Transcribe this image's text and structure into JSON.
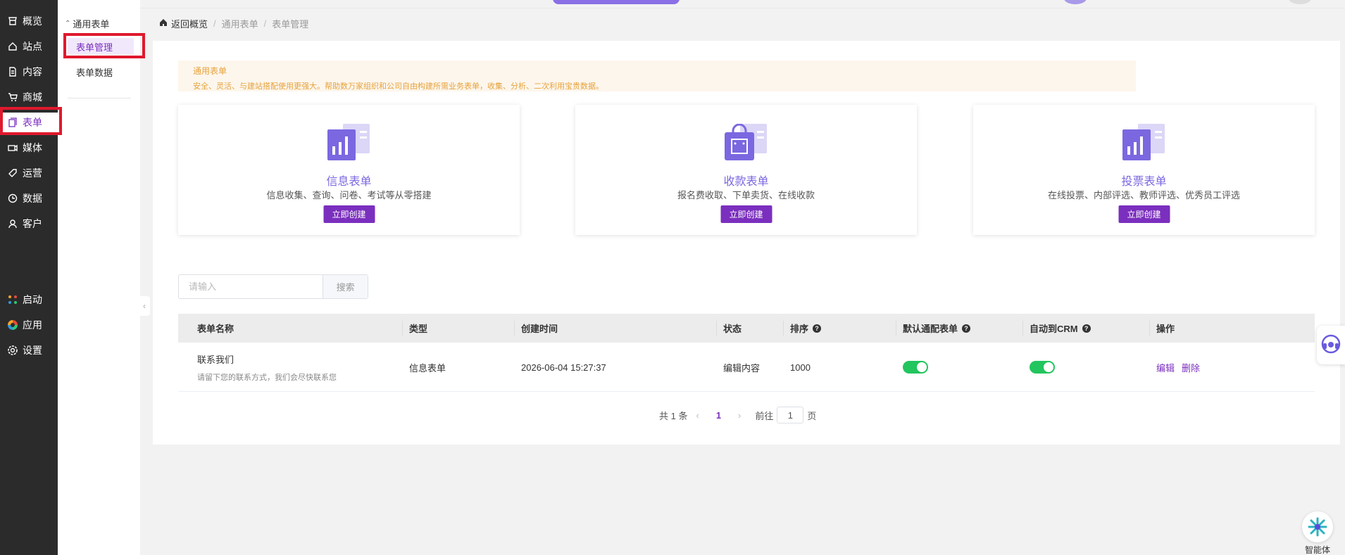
{
  "sidebar": {
    "items": [
      {
        "label": "概览",
        "icon": "storefront-icon"
      },
      {
        "label": "站点",
        "icon": "home-icon"
      },
      {
        "label": "内容",
        "icon": "document-icon"
      },
      {
        "label": "商城",
        "icon": "cart-icon"
      },
      {
        "label": "表单",
        "icon": "forms-icon"
      },
      {
        "label": "媒体",
        "icon": "video-icon"
      },
      {
        "label": "运营",
        "icon": "tag-icon"
      },
      {
        "label": "数据",
        "icon": "clock-icon"
      },
      {
        "label": "客户",
        "icon": "user-icon"
      }
    ],
    "bottom_items": [
      {
        "label": "启动",
        "icon": "launch-icon"
      },
      {
        "label": "应用",
        "icon": "apps-icon"
      },
      {
        "label": "设置",
        "icon": "gear-icon"
      }
    ],
    "active": "表单"
  },
  "subbar": {
    "group": "通用表单",
    "items": [
      "表单管理",
      "表单数据"
    ],
    "active": "表单管理"
  },
  "breadcrumb": {
    "home": "返回概览",
    "items": [
      "通用表单",
      "表单管理"
    ]
  },
  "notice": {
    "title": "通用表单",
    "desc": "安全、灵活、与建站搭配使用更强大。帮助数万家组织和公司自由构建所需业务表单，收集、分析、二次利用宝贵数据。"
  },
  "cards": [
    {
      "title": "信息表单",
      "desc": "信息收集、查询、问卷、考试等从零搭建",
      "button": "立即创建"
    },
    {
      "title": "收款表单",
      "desc": "报名费收取、下单卖货、在线收款",
      "button": "立即创建"
    },
    {
      "title": "投票表单",
      "desc": "在线投票、内部评选、教师评选、优秀员工评选",
      "button": "立即创建"
    }
  ],
  "search": {
    "placeholder": "请输入",
    "button": "搜索"
  },
  "table": {
    "columns": [
      "表单名称",
      "类型",
      "创建时间",
      "状态",
      "排序",
      "默认通配表单",
      "自动到CRM",
      "操作"
    ],
    "rows": [
      {
        "name": "联系我们",
        "name_sub": "请留下您的联系方式，我们会尽快联系您",
        "type": "信息表单",
        "created": "2026-06-04 15:27:37",
        "status": "编辑内容",
        "order": "1000",
        "default_form": true,
        "auto_crm": true,
        "actions": [
          "编辑",
          "删除"
        ]
      }
    ]
  },
  "pagination": {
    "total": "共 1 条",
    "current": "1",
    "goto_prefix": "前往",
    "goto_value": "1",
    "goto_suffix": "页"
  },
  "agent": {
    "label": "智能体"
  },
  "colors": {
    "accent": "#7b2fbe",
    "sidebar_bg": "#2b2b2b",
    "highlight": "#e0192d",
    "toggle_on": "#22c55e",
    "notice_text": "#e6a23c"
  }
}
